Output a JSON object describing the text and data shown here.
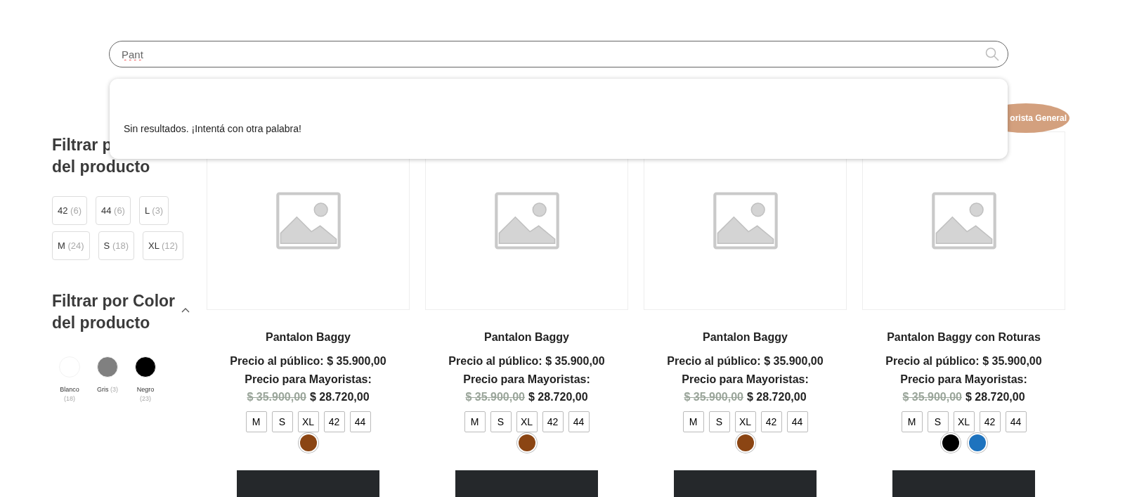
{
  "search": {
    "value": "Pant"
  },
  "search_results": {
    "message": "Sin resultados. ¡Intentá con otra palabra!"
  },
  "badge": {
    "label": "orista General"
  },
  "size_filter": {
    "title_lines": [
      "Filtrar p",
      "del producto"
    ],
    "options": [
      {
        "label": "42",
        "count": "(6)"
      },
      {
        "label": "44",
        "count": "(6)"
      },
      {
        "label": "L",
        "count": "(3)"
      },
      {
        "label": "M",
        "count": "(24)"
      },
      {
        "label": "S",
        "count": "(18)"
      },
      {
        "label": "XL",
        "count": "(12)"
      }
    ]
  },
  "color_filter": {
    "title_lines": [
      "Filtrar por Color",
      "del producto"
    ],
    "expanded": true,
    "options": [
      {
        "name": "Blanco",
        "count": "(18)",
        "color": "#ffffff"
      },
      {
        "name": "Gris",
        "count": "(3)",
        "color": "#808080"
      },
      {
        "name": "Negro",
        "count": "(23)",
        "color": "#000000"
      }
    ]
  },
  "products": [
    {
      "title": "Pantalon Baggy",
      "public_price": "Precio al público: $ 35.900,00",
      "wholesale_label": "Precio para Mayoristas:",
      "old_price": "$ 35.900,00",
      "price": "$ 28.720,00",
      "sizes": [
        "M",
        "S",
        "XL",
        "42",
        "44"
      ],
      "colors": [
        {
          "color": "#8b4513"
        }
      ]
    },
    {
      "title": "Pantalon Baggy",
      "public_price": "Precio al público: $ 35.900,00",
      "wholesale_label": "Precio para Mayoristas:",
      "old_price": "$ 35.900,00",
      "price": "$ 28.720,00",
      "sizes": [
        "M",
        "S",
        "XL",
        "42",
        "44"
      ],
      "colors": [
        {
          "color": "#8b4513"
        }
      ]
    },
    {
      "title": "Pantalon Baggy",
      "public_price": "Precio al público: $ 35.900,00",
      "wholesale_label": "Precio para Mayoristas:",
      "old_price": "$ 35.900,00",
      "price": "$ 28.720,00",
      "sizes": [
        "M",
        "S",
        "XL",
        "42",
        "44"
      ],
      "colors": [
        {
          "color": "#8b4513"
        }
      ]
    },
    {
      "title": "Pantalon Baggy con Roturas",
      "public_price": "Precio al público: $ 35.900,00",
      "wholesale_label": "Precio para Mayoristas:",
      "old_price": "$ 35.900,00",
      "price": "$ 28.720,00",
      "sizes": [
        "M",
        "S",
        "XL",
        "42",
        "44"
      ],
      "colors": [
        {
          "color": "#000000"
        },
        {
          "color": "#1e73be"
        }
      ]
    }
  ]
}
